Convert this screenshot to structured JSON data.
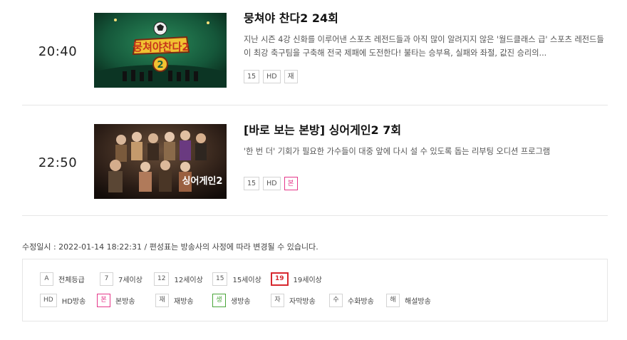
{
  "programs": [
    {
      "time": "20:40",
      "title": "뭉쳐야 찬다2 24회",
      "description": "지난 시즌 4강 신화를 이루어낸 스포츠 레전드들과 아직 많이 알려지지 않은 '월드클래스 급' 스포츠 레전드들이 최강 축구팀을 구축해 전국 제패에 도전한다! 불타는 승부욕, 실패와 좌절, 값진 승리의...",
      "thumbnail_text": "뭉쳐야찬다2",
      "badges": [
        "15",
        "HD",
        "재"
      ]
    },
    {
      "time": "22:50",
      "title": "[바로 보는 본방] 싱어게인2 7회",
      "description": "'한 번 더' 기회가 필요한 가수들이 대중 앞에 다시 설 수 있도록 돕는 리부팅 오디션 프로그램",
      "thumbnail_text": "싱어게인2",
      "badges": [
        "15",
        "HD",
        "본"
      ]
    }
  ],
  "notice": "수정일시 : 2022-01-14 18:22:31 / 편성표는 방송사의 사정에 따라 변경될 수 있습니다.",
  "legend": {
    "ratings": [
      {
        "badge": "A",
        "label": "전체등급"
      },
      {
        "badge": "7",
        "label": "7세이상"
      },
      {
        "badge": "12",
        "label": "12세이상"
      },
      {
        "badge": "15",
        "label": "15세이상"
      },
      {
        "badge": "19",
        "label": "19세이상"
      }
    ],
    "types": [
      {
        "badge": "HD",
        "label": "HD방송"
      },
      {
        "badge": "본",
        "label": "본방송"
      },
      {
        "badge": "재",
        "label": "재방송"
      },
      {
        "badge": "생",
        "label": "생방송"
      },
      {
        "badge": "자",
        "label": "자막방송"
      },
      {
        "badge": "수",
        "label": "수화방송"
      },
      {
        "badge": "해",
        "label": "해설방송"
      }
    ]
  },
  "colors": {
    "pink": "#e5388a",
    "red": "#d7282f",
    "green": "#4aa53a",
    "border": "#d4d4d4"
  }
}
